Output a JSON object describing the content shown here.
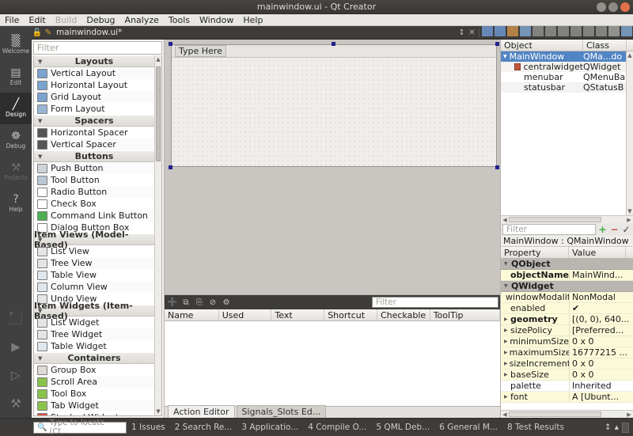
{
  "titlebar": {
    "title": "mainwindow.ui - Qt Creator",
    "minimize": "minimize-button",
    "maximize": "maximize-button",
    "close": "close-button"
  },
  "menubar": {
    "items": [
      {
        "label": "File",
        "disabled": false
      },
      {
        "label": "Edit",
        "disabled": false
      },
      {
        "label": "Build",
        "disabled": true
      },
      {
        "label": "Debug",
        "disabled": false
      },
      {
        "label": "Analyze",
        "disabled": false
      },
      {
        "label": "Tools",
        "disabled": false
      },
      {
        "label": "Window",
        "disabled": false
      },
      {
        "label": "Help",
        "disabled": false
      }
    ]
  },
  "modebar": {
    "items": [
      {
        "label": "Welcome",
        "icon": "grid-icon",
        "glyph": "▒",
        "state": "normal"
      },
      {
        "label": "Edit",
        "icon": "document-icon",
        "glyph": "▤",
        "state": "normal"
      },
      {
        "label": "Design",
        "icon": "pencil-icon",
        "glyph": "╱",
        "state": "active"
      },
      {
        "label": "Debug",
        "icon": "bug-icon",
        "glyph": "☸",
        "state": "normal"
      },
      {
        "label": "Projects",
        "icon": "wrench-icon",
        "glyph": "⚒",
        "state": "dim"
      },
      {
        "label": "Help",
        "icon": "question-icon",
        "glyph": "?",
        "state": "normal"
      }
    ],
    "bottom": [
      {
        "name": "kit-selector-icon",
        "glyph": "⬛"
      },
      {
        "name": "run-icon",
        "glyph": "▶"
      },
      {
        "name": "debug-run-icon",
        "glyph": "▷"
      },
      {
        "name": "build-hammer-icon",
        "glyph": "⚒"
      }
    ]
  },
  "filebar": {
    "lock_icon": "🔓",
    "file_icon": "📝",
    "filename": "mainwindow.ui*",
    "split_icon": "↕",
    "close_icon": "✕",
    "toolbar_icons": [
      "edit-widgets-icon",
      "edit-signals-slots-icon",
      "edit-buddies-icon",
      "edit-tab-order-icon",
      "layout-horizontal-icon",
      "layout-vertical-icon",
      "layout-splitter-horizontal-icon",
      "layout-splitter-vertical-icon",
      "layout-form-icon",
      "layout-grid-icon",
      "break-layout-icon",
      "adjust-size-icon"
    ]
  },
  "widgetbox": {
    "filter_placeholder": "Filter",
    "categories": [
      {
        "name": "Layouts",
        "items": [
          {
            "label": "Vertical Layout",
            "icon": "vertical-layout-icon"
          },
          {
            "label": "Horizontal Layout",
            "icon": "horizontal-layout-icon"
          },
          {
            "label": "Grid Layout",
            "icon": "grid-layout-icon"
          },
          {
            "label": "Form Layout",
            "icon": "form-layout-icon"
          }
        ]
      },
      {
        "name": "Spacers",
        "items": [
          {
            "label": "Horizontal Spacer",
            "icon": "horizontal-spacer-icon"
          },
          {
            "label": "Vertical Spacer",
            "icon": "vertical-spacer-icon"
          }
        ]
      },
      {
        "name": "Buttons",
        "items": [
          {
            "label": "Push Button",
            "icon": "push-button-icon"
          },
          {
            "label": "Tool Button",
            "icon": "tool-button-icon"
          },
          {
            "label": "Radio Button",
            "icon": "radio-button-icon"
          },
          {
            "label": "Check Box",
            "icon": "check-box-icon"
          },
          {
            "label": "Command Link Button",
            "icon": "command-link-button-icon"
          },
          {
            "label": "Dialog Button Box",
            "icon": "dialog-button-box-icon"
          }
        ]
      },
      {
        "name": "Item Views (Model-Based)",
        "items": [
          {
            "label": "List View",
            "icon": "list-view-icon"
          },
          {
            "label": "Tree View",
            "icon": "tree-view-icon"
          },
          {
            "label": "Table View",
            "icon": "table-view-icon"
          },
          {
            "label": "Column View",
            "icon": "column-view-icon"
          },
          {
            "label": "Undo View",
            "icon": "undo-view-icon"
          }
        ]
      },
      {
        "name": "Item Widgets (Item-Based)",
        "items": [
          {
            "label": "List Widget",
            "icon": "list-widget-icon"
          },
          {
            "label": "Tree Widget",
            "icon": "tree-widget-icon"
          },
          {
            "label": "Table Widget",
            "icon": "table-widget-icon"
          }
        ]
      },
      {
        "name": "Containers",
        "items": [
          {
            "label": "Group Box",
            "icon": "group-box-icon"
          },
          {
            "label": "Scroll Area",
            "icon": "scroll-area-icon"
          },
          {
            "label": "Tool Box",
            "icon": "tool-box-icon"
          },
          {
            "label": "Tab Widget",
            "icon": "tab-widget-icon"
          },
          {
            "label": "Stacked Widget",
            "icon": "stacked-widget-icon"
          }
        ]
      }
    ]
  },
  "formeditor": {
    "menubar_placeholder": "Type Here"
  },
  "actioneditor": {
    "toolbar_icons": [
      "new-action-icon",
      "copy-icon",
      "paste-icon",
      "delete-icon",
      "settings-icon"
    ],
    "filter_placeholder": "Filter",
    "columns": [
      "Name",
      "Used",
      "Text",
      "Shortcut",
      "Checkable",
      "ToolTip"
    ],
    "rows": []
  },
  "viewtabs": {
    "tabs": [
      {
        "label": "Action Editor",
        "active": true
      },
      {
        "label": "Signals_Slots Ed...",
        "active": false
      }
    ]
  },
  "objectinspector": {
    "columns": [
      "Object",
      "Class"
    ],
    "rows": [
      {
        "object": "MainWindow",
        "class": "QMa...do",
        "indent": 0,
        "selected": true,
        "icon": "expand-arrow-icon"
      },
      {
        "object": "centralwidget",
        "class": "QWidget",
        "indent": 1,
        "selected": false,
        "icon": "widget-icon"
      },
      {
        "object": "menubar",
        "class": "QMenuBa",
        "indent": 1,
        "selected": false,
        "icon": ""
      },
      {
        "object": "statusbar",
        "class": "QStatusB",
        "indent": 1,
        "selected": false,
        "icon": ""
      }
    ]
  },
  "propertyeditor": {
    "filter_placeholder": "Filter",
    "add_button": "+",
    "remove_button": "−",
    "configure_button": "configure-icon",
    "object_title": "MainWindow : QMainWindow",
    "columns": [
      "Property",
      "Value"
    ],
    "rows": [
      {
        "kind": "group",
        "name": "QObject"
      },
      {
        "kind": "prop",
        "name": "objectName",
        "value": "MainWind...",
        "bold": true,
        "expandable": false
      },
      {
        "kind": "group",
        "name": "QWidget"
      },
      {
        "kind": "prop",
        "name": "windowModality",
        "value": "NonModal",
        "bold": false,
        "expandable": false
      },
      {
        "kind": "prop",
        "name": "enabled",
        "value": "✔",
        "bold": false,
        "expandable": false
      },
      {
        "kind": "prop",
        "name": "geometry",
        "value": "[(0, 0), 640...",
        "bold": true,
        "expandable": true
      },
      {
        "kind": "prop",
        "name": "sizePolicy",
        "value": "[Preferred...",
        "bold": false,
        "expandable": true
      },
      {
        "kind": "prop",
        "name": "minimumSize",
        "value": "0 x 0",
        "bold": false,
        "expandable": true
      },
      {
        "kind": "prop",
        "name": "maximumSize",
        "value": "16777215 ...",
        "bold": false,
        "expandable": true
      },
      {
        "kind": "prop",
        "name": "sizeIncrement",
        "value": "0 x 0",
        "bold": false,
        "expandable": true
      },
      {
        "kind": "prop",
        "name": "baseSize",
        "value": "0 x 0",
        "bold": false,
        "expandable": true
      },
      {
        "kind": "prop",
        "name": "palette",
        "value": "Inherited",
        "bold": false,
        "expandable": false
      },
      {
        "kind": "prop",
        "name": "font",
        "value": "A  [Ubunt...",
        "bold": false,
        "expandable": true
      }
    ]
  },
  "statusbar": {
    "locator_icon": "search-icon",
    "locator_placeholder": "Type to locate (Ct...",
    "panes": [
      "1 Issues",
      "2 Search Re...",
      "3 Applicatio...",
      "4 Compile O...",
      "5 QML Deb...",
      "6 General M...",
      "8 Test Results"
    ],
    "spinner": "↕",
    "collapse": "▲"
  }
}
